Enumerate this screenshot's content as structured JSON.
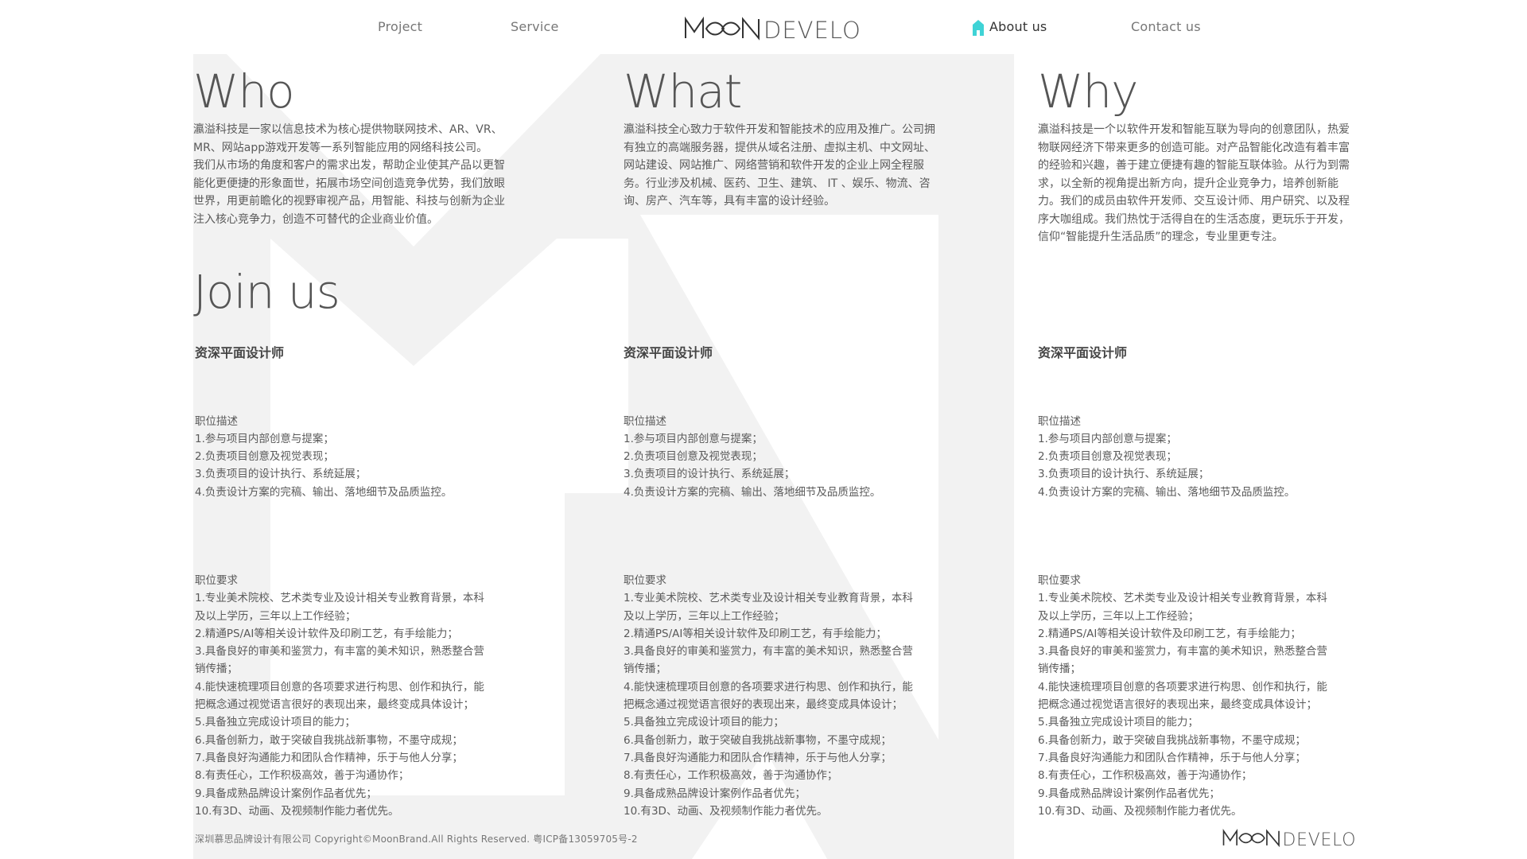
{
  "nav": {
    "project": "Project",
    "service": "Service",
    "about": "About us",
    "contact": "Contact us",
    "logo_text": "MOONDEVELOP"
  },
  "sections": {
    "who": {
      "title": "Who",
      "text": "瀛溢科技是一家以信息技术为核心提供物联网技术、AR、VR、\nMR、网站app游戏开发等一系列智能应用的网络科技公司。\n我们从市场的角度和客户的需求出发，帮助企业使其产品以更智\n能化更便捷的形象面世，拓展市场空间创造竞争优势，我们放眼\n世界，用更前瞻化的视野审视产品，用智能、科技与创新为企业\n注入核心竞争力，创造不可替代的企业商业价值。"
    },
    "what": {
      "title": "What",
      "text": "瀛溢科技全心致力于软件开发和智能技术的应用及推广。公司拥\n有独立的高端服务器，提供从域名注册、虚拟主机、中文网址、\n网站建设、网站推广、网络营销和软件开发的企业上网全程服\n务。行业涉及机械、医药、卫生、建筑、 IT 、娱乐、物流、咨\n询、房产、汽车等，具有丰富的设计经验。"
    },
    "why": {
      "title": "Why",
      "text": "瀛溢科技是一个以软件开发和智能互联为导向的创意团队，热爱\n物联网经济下带来更多的创造可能。对产品智能化改造有着丰富\n的经验和兴趣，善于建立便捷有趣的智能互联体验。从行为到需\n求，以全新的视角提出新方向，提升企业竞争力，培养创新能\n力。我们的成员由软件开发师、交互设计师、用户研究、以及程\n序大咖组成。我们热忱于活得自在的生活态度，更玩乐于开发，\n信仰“智能提升生活品质”的理念，专业里更专注。"
    },
    "join": {
      "title": "Join us"
    }
  },
  "jobs": [
    {
      "title": "资深平面设计师",
      "desc_label": "职位描述",
      "desc": "1.参与项目内部创意与提案；\n2.负责项目创意及视觉表现；\n3.负责项目的设计执行、系统延展；\n4.负责设计方案的完稿、输出、落地细节及品质监控。",
      "req_label": "职位要求",
      "req": "1.专业美术院校、艺术类专业及设计相关专业教育背景，本科\n及以上学历，三年以上工作经验；\n2.精通PS/AI等相关设计软件及印刷工艺，有手绘能力；\n3.具备良好的审美和鉴赏力，有丰富的美术知识，熟悉整合营\n销传播；\n4.能快速梳理项目创意的各项要求进行构思、创作和执行，能\n把概念通过视觉语言很好的表现出来，最终变成具体设计；\n5.具备独立完成设计项目的能力；\n6.具备创新力，敢于突破自我挑战新事物，不墨守成规；\n7.具备良好沟通能力和团队合作精神，乐于与他人分享；\n8.有责任心，工作积极高效，善于沟通协作；\n9.具备成熟品牌设计案例作品者优先；\n10.有3D、动画、及视频制作能力者优先。"
    },
    {
      "title": "资深平面设计师",
      "desc_label": "职位描述",
      "desc": "1.参与项目内部创意与提案；\n2.负责项目创意及视觉表现；\n3.负责项目的设计执行、系统延展；\n4.负责设计方案的完稿、输出、落地细节及品质监控。",
      "req_label": "职位要求",
      "req": "1.专业美术院校、艺术类专业及设计相关专业教育背景，本科\n及以上学历，三年以上工作经验；\n2.精通PS/AI等相关设计软件及印刷工艺，有手绘能力；\n3.具备良好的审美和鉴赏力，有丰富的美术知识，熟悉整合营\n销传播；\n4.能快速梳理项目创意的各项要求进行构思、创作和执行，能\n把概念通过视觉语言很好的表现出来，最终变成具体设计；\n5.具备独立完成设计项目的能力；\n6.具备创新力，敢于突破自我挑战新事物，不墨守成规；\n7.具备良好沟通能力和团队合作精神，乐于与他人分享；\n8.有责任心，工作积极高效，善于沟通协作；\n9.具备成熟品牌设计案例作品者优先；\n10.有3D、动画、及视频制作能力者优先。"
    },
    {
      "title": "资深平面设计师",
      "desc_label": "职位描述",
      "desc": "1.参与项目内部创意与提案；\n2.负责项目创意及视觉表现；\n3.负责项目的设计执行、系统延展；\n4.负责设计方案的完稿、输出、落地细节及品质监控。",
      "req_label": "职位要求",
      "req": "1.专业美术院校、艺术类专业及设计相关专业教育背景，本科\n及以上学历，三年以上工作经验；\n2.精通PS/AI等相关设计软件及印刷工艺，有手绘能力；\n3.具备良好的审美和鉴赏力，有丰富的美术知识，熟悉整合营\n销传播；\n4.能快速梳理项目创意的各项要求进行构思、创作和执行，能\n把概念通过视觉语言很好的表现出来，最终变成具体设计；\n5.具备独立完成设计项目的能力；\n6.具备创新力，敢于突破自我挑战新事物，不墨守成规；\n7.具备良好沟通能力和团队合作精神，乐于与他人分享；\n8.有责任心，工作积极高效，善于沟通协作；\n9.具备成熟品牌设计案例作品者优先；\n10.有3D、动画、及视频制作能力者优先。"
    }
  ],
  "footer": {
    "copyright": "深圳慕思品牌设计有限公司 Copyright©MoonBrand.All Rights Reserved.   粤ICP备13059705号-2",
    "logo_text": "MOONDEVELOP"
  },
  "colors": {
    "background": "#ffffff",
    "decor_shape": "#f2f2f2",
    "text": "#555555",
    "accent": "#3fd3d6"
  }
}
